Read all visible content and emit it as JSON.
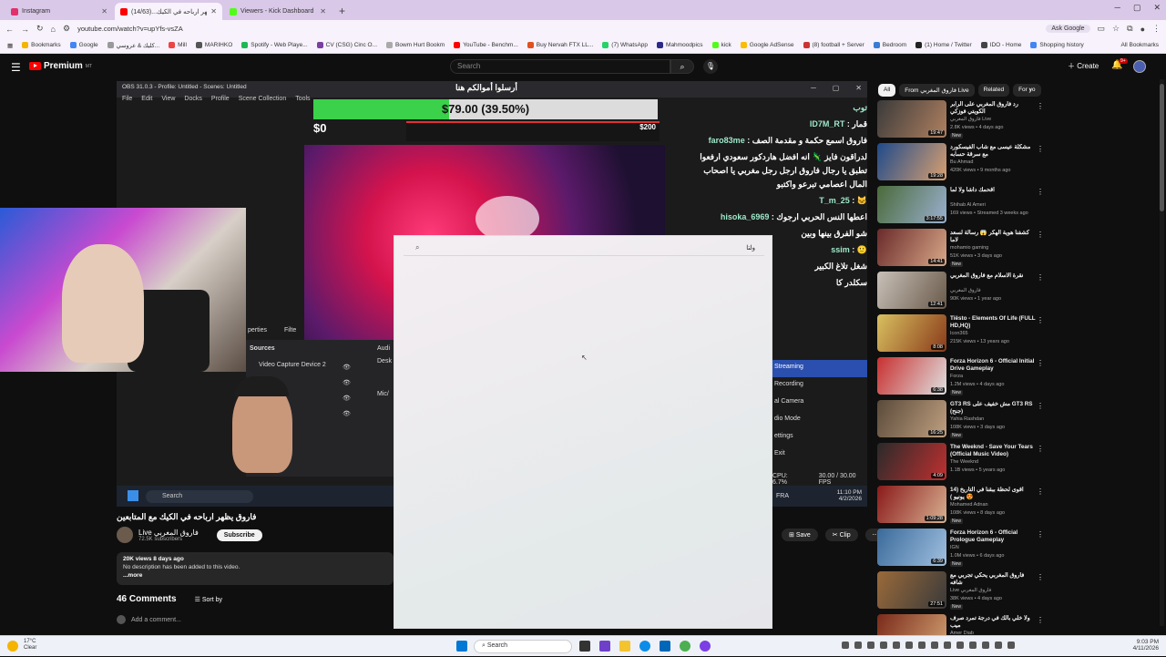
{
  "tabs": [
    {
      "title": "Instagram",
      "color": "#e1306c"
    },
    {
      "title": "(فاروق يظهر ارباحه في الكيك...(14/63",
      "color": "#ff0000"
    },
    {
      "title": "Viewers - Kick Dashboard",
      "color": "#53fc18"
    }
  ],
  "address": {
    "url": "youtube.com/watch?v=upYfs-vsZA",
    "ask_google": "Ask Google"
  },
  "bookmarks": [
    "Bookmarks",
    "Google",
    "كليك & عروسي...",
    "Mill",
    "MARIHKO",
    "Spotify - Web Playe...",
    "CV (CSG) Cinc O...",
    "Bowm Hurt Bookm",
    "YouTube - Benchm...",
    "Buy Nervah FTX LL...",
    "(7) WhatsApp",
    "Mahmoodpics",
    "kick",
    "Google AdSense",
    "(8) football + Server",
    "Bedroom",
    "(1) Home / Twitter",
    "IDO - Home",
    "Shopping history",
    "All Bookmarks"
  ],
  "header": {
    "logo": "Premium",
    "logo_sup": "MT",
    "search_placeholder": "Search",
    "create": "Create",
    "notif_count": "9+"
  },
  "stream": {
    "obs_title": "OBS 31.0.3 - Profile: Untitled - Scenes: Untitled",
    "menu": [
      "File",
      "Edit",
      "View",
      "Docks",
      "Profile",
      "Scene Collection",
      "Tools"
    ],
    "banner": "أرسلوا أموالكم هنا",
    "goal_text": "$79.00 (39.50%)",
    "goal_fraction": 0.395,
    "goal_start": "$0",
    "goal_end": "$200",
    "chat": [
      {
        "user": "توب",
        "msg": ""
      },
      {
        "user": "ID7M_RT",
        "msg": ": قمار"
      },
      {
        "user": "faro83me",
        "msg": ": فاروق اسمع حكمة و مقدمة الصف"
      },
      {
        "user": "",
        "msg": "لدراقون فايز 🦎 انه افضل هاردكور سعودي ارفعوا تطبق يا رجال فاروق ارجل رجل مغربي يا اصحاب المال اعصامي تبرعو واكتبو"
      },
      {
        "user": "T_m_25",
        "msg": ": 🐱"
      },
      {
        "user": "hisoka_6969",
        "msg": ": اعطها النس الحربي ارجوك"
      },
      {
        "user": "",
        "msg": "شو الفرق بينها وبين"
      },
      {
        "user": "ssim",
        "msg": ": 🙂"
      },
      {
        "user": "",
        "msg": "شغل تلاغ الكبير"
      },
      {
        "user": "",
        "msg": "سكلدر كا"
      }
    ],
    "dock": {
      "properties": "perties",
      "filters": "Filte",
      "sources": "Sources",
      "audio": "Audi",
      "source_item": "Video Capture Device 2",
      "desk": "Desk",
      "mic": "Mic/"
    },
    "controls": [
      "Streaming",
      "Recording",
      "al Camera",
      "dio Mode",
      "ettings",
      "Exit"
    ],
    "cpu": "CPU: 6.7%",
    "fps": "30.00 / 30.00 FPS",
    "inner_search": "Search",
    "inner_lang": "FRA",
    "inner_time": "11:10 PM",
    "inner_date": "4/2/2026"
  },
  "video": {
    "title": "فاروق يظهر ارباحه في الكيك مع المتابعين",
    "channel": "Live فاروق المغربي",
    "subs": "72.5K subscribers",
    "subscribe": "Subscribe",
    "save": "Save",
    "clip": "Clip",
    "views": "20K views  8 days ago",
    "desc": "No description has been added to this video.",
    "more": "...more",
    "comments": "46 Comments",
    "sort": "Sort by",
    "add_comment": "Add a comment..."
  },
  "overlay": {
    "query": "ولتا"
  },
  "chips": [
    "All",
    "From فاروق المغربي Live",
    "Related",
    "For yo"
  ],
  "recs": [
    {
      "title": "رد فاروق المغربي على الرابر الكويتي فوزكي",
      "channel": "فاروق المغربي Live",
      "meta": "2.8K views • 4 days ago",
      "new": "New",
      "dur": "19:47",
      "c": [
        "#3a3a3a",
        "#b08060"
      ]
    },
    {
      "title": "مشكلة عيسى مع شاب الفيسكورد مع سرقة حسابه",
      "channel": "Bu Ahmad",
      "meta": "420K views • 9 months ago",
      "new": "",
      "dur": "19:28",
      "c": [
        "#1f4a8a",
        "#d9a070"
      ]
    },
    {
      "title": "اقحمك داشا ولا لما",
      "channel": "Shihab Al Ameri",
      "meta": "169 views • Streamed 3 weeks ago",
      "new": "",
      "dur": "3:17:55",
      "c": [
        "#4a6a3a",
        "#9ab0d0"
      ]
    },
    {
      "title": "كشفنا هوية الهكر 😱 رسالة لسعد لاما",
      "channel": "mohamio gaming",
      "meta": "51K views • 3 days ago",
      "new": "New",
      "dur": "14:41",
      "c": [
        "#6a2a2a",
        "#d8a888"
      ]
    },
    {
      "title": "نقرة الاسلام مع فاروق المغربي",
      "channel": "فاروق المغربي",
      "meta": "90K views • 1 year ago",
      "new": "",
      "dur": "12:41",
      "c": [
        "#c8c0b8",
        "#6a5a4a"
      ]
    },
    {
      "title": "Tiësto - Elements Of Life (FULL HD,HQ)",
      "channel": "Icon365",
      "meta": "215K views • 13 years ago",
      "new": "",
      "dur": "8:08",
      "c": [
        "#d8c060",
        "#8a3a1a"
      ]
    },
    {
      "title": "Forza Horizon 6 - Official Initial Drive Gameplay",
      "channel": "Forza",
      "meta": "1.2M views • 4 days ago",
      "new": "New",
      "dur": "6:38",
      "c": [
        "#c83030",
        "#e0e0e0"
      ]
    },
    {
      "title": "GT3 RS مش خفيف على GT3 RS (جنح)",
      "channel": "Yahia Rashdan",
      "meta": "108K views • 3 days ago",
      "new": "New",
      "dur": "16:25",
      "c": [
        "#5a4a3a",
        "#c0a080"
      ]
    },
    {
      "title": "The Weeknd - Save Your Tears (Official Music Video)",
      "channel": "The Weeknd",
      "meta": "1.1B views • 5 years ago",
      "new": "",
      "dur": "4:09",
      "c": [
        "#2a2a2a",
        "#c03030"
      ]
    },
    {
      "title": "اقوى لحظة ببقنا في التاريخ (14 يونيو ) 😍",
      "channel": "Mohamed Adnan",
      "meta": "108K views • 8 days ago",
      "new": "New",
      "dur": "1:09:28",
      "c": [
        "#8a1a1a",
        "#d8b090"
      ]
    },
    {
      "title": "Forza Horizon 6 - Official Prologue Gameplay",
      "channel": "IGN",
      "meta": "1.0M views • 6 days ago",
      "new": "New",
      "dur": "6:39",
      "c": [
        "#3a6a9a",
        "#a0c0e0"
      ]
    },
    {
      "title": "فاروق المغربي يحكي تجربي مع شافه",
      "channel": "Live فاروق المغربي",
      "meta": "38K views • 4 days ago",
      "new": "New",
      "dur": "27:51",
      "c": [
        "#9a6a3a",
        "#3a3a3a"
      ]
    },
    {
      "title": "ولا خلي بالك في درجة تمرد صرف ميب",
      "channel": "Amer Diab",
      "meta": "",
      "new": "",
      "dur": "",
      "c": [
        "#7a2a1a",
        "#d0a070"
      ]
    }
  ],
  "taskbar": {
    "temp": "17°C",
    "cond": "Clear",
    "search": "Search",
    "time": "9:03 PM",
    "date": "4/11/2026"
  },
  "colors": {
    "yt_red": "#ff0000",
    "stream_highlight": "#2a4fae",
    "goal_green": "#3bd14a"
  }
}
